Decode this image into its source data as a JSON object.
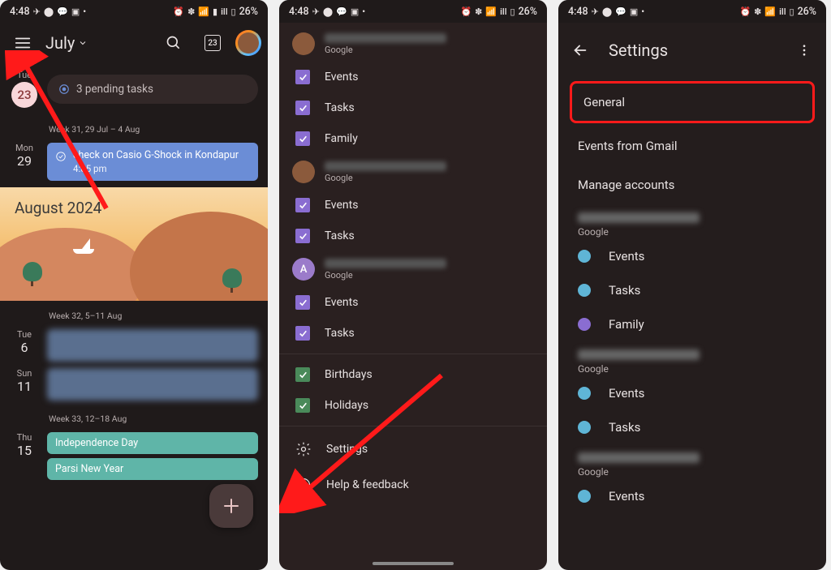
{
  "status": {
    "time": "4:48",
    "battery": "26%"
  },
  "screen1": {
    "month_label": "July",
    "today_number": "23",
    "pending": {
      "day_abbr": "Tue",
      "day_num": "23",
      "text": "3 pending tasks"
    },
    "week1_label": "Week 31, 29 Jul – 4 Aug",
    "mon29": {
      "abbr": "Mon",
      "num": "29"
    },
    "event1": {
      "title": "check on Casio G-Shock in Kondapur",
      "time": "4:05 pm"
    },
    "month_hero": "August 2024",
    "week2_label": "Week 32, 5–11 Aug",
    "tue6": {
      "abbr": "Tue",
      "num": "6"
    },
    "sun11": {
      "abbr": "Sun",
      "num": "11"
    },
    "week3_label": "Week 33, 12–18 Aug",
    "thu15": {
      "abbr": "Thu",
      "num": "15"
    },
    "ind_day": "Independence Day",
    "parsi": "Parsi New Year"
  },
  "screen2": {
    "provider": "Google",
    "items_acc1": [
      "Events",
      "Tasks",
      "Family"
    ],
    "items_acc2": [
      "Events",
      "Tasks"
    ],
    "avatar_letter": "A",
    "items_acc3": [
      "Events",
      "Tasks"
    ],
    "birthdays": "Birthdays",
    "holidays": "Holidays",
    "settings": "Settings",
    "help": "Help & feedback"
  },
  "screen3": {
    "title": "Settings",
    "general": "General",
    "events_gmail": "Events from Gmail",
    "manage": "Manage accounts",
    "provider": "Google",
    "items_a": [
      "Events",
      "Tasks",
      "Family"
    ],
    "items_b": [
      "Events",
      "Tasks"
    ],
    "items_c": [
      "Events"
    ]
  }
}
